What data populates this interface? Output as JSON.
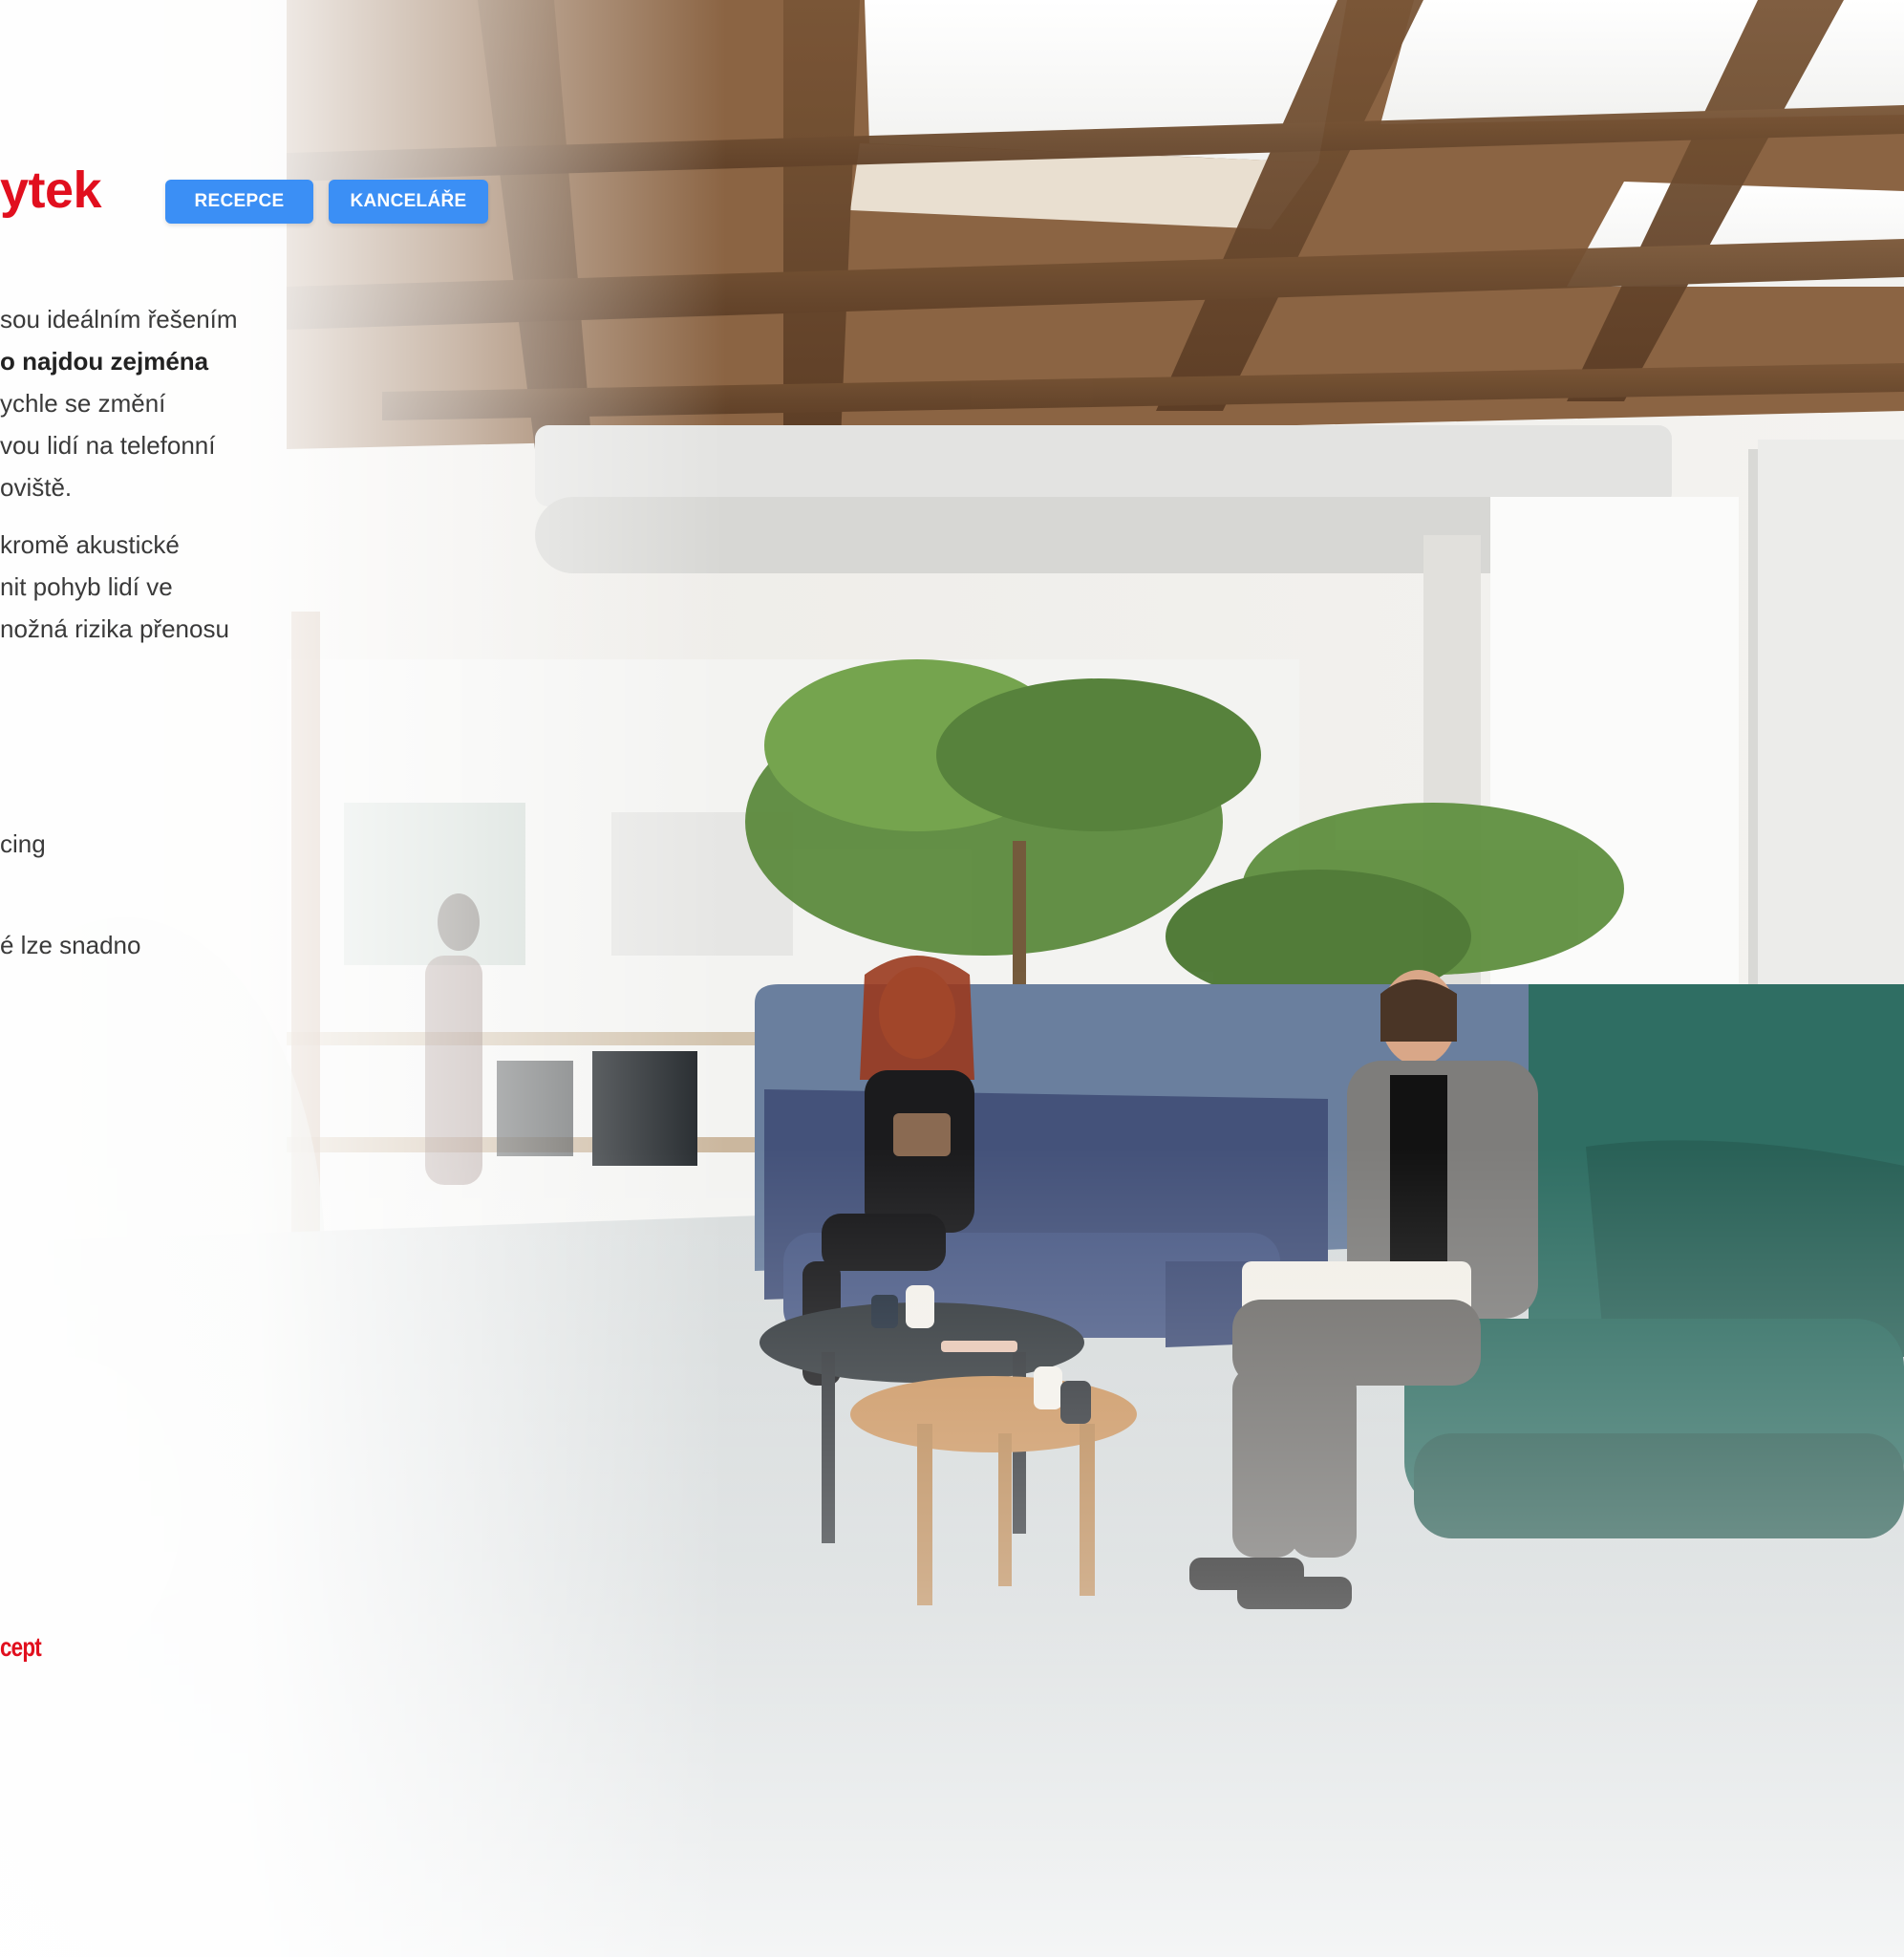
{
  "hero": {
    "title": "ytek",
    "tags": [
      "RECEPCE",
      "KANCELÁŘE"
    ]
  },
  "intro": {
    "lines": [
      {
        "text": "sou ideálním řešením",
        "bold": false
      },
      {
        "text": "o najdou zejména",
        "bold": true
      },
      {
        "text": "ychle se změní",
        "bold": false
      },
      {
        "text": "vou lidí na telefonní",
        "bold": false
      },
      {
        "text": "oviště.",
        "bold": false
      }
    ]
  },
  "detail": {
    "lines": [
      "kromě akustické",
      "nit pohyb lidí ve",
      "nožná rizika přenosu"
    ]
  },
  "fragments": {
    "distancing": "cing",
    "easily": "é lze snadno"
  },
  "brand": {
    "text": "cept"
  },
  "photo": {
    "icon": "office-lounge-photo"
  }
}
